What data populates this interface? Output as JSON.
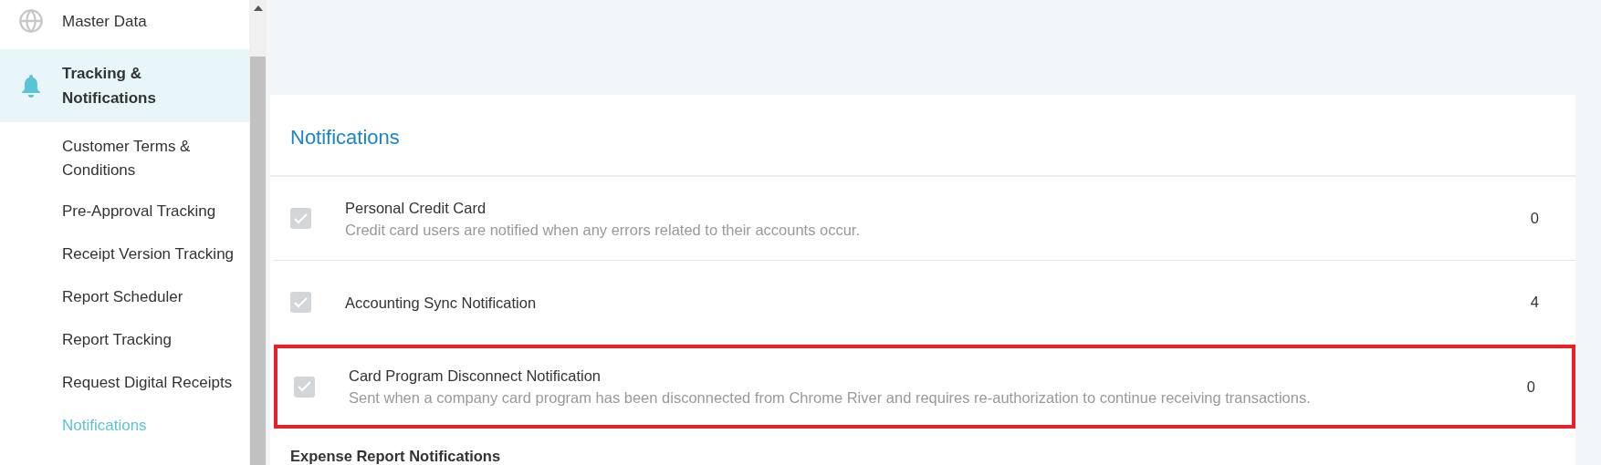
{
  "sidebar": {
    "items": [
      {
        "label": "Master Data",
        "kind": "globe",
        "selected": false
      },
      {
        "label": "Tracking & Notifications",
        "kind": "bell",
        "selected": true,
        "children": [
          {
            "label": "Customer Terms & Conditions",
            "selected": false
          },
          {
            "label": "Pre-Approval Tracking",
            "selected": false
          },
          {
            "label": "Receipt Version Tracking",
            "selected": false
          },
          {
            "label": "Report Scheduler",
            "selected": false
          },
          {
            "label": "Report Tracking",
            "selected": false
          },
          {
            "label": "Request Digital Receipts",
            "selected": false
          },
          {
            "label": "Notifications",
            "selected": true
          }
        ]
      }
    ]
  },
  "page": {
    "title": "Notifications",
    "notifications": [
      {
        "name": "Personal Credit Card",
        "description": "Credit card users are notified when any errors related to their accounts occur.",
        "count": "0",
        "checked": true,
        "highlighted": false
      },
      {
        "name": "Accounting Sync Notification",
        "count": "4",
        "checked": true,
        "highlighted": false
      },
      {
        "name": "Card Program Disconnect Notification",
        "description": "Sent when a company card program has been disconnected from Chrome River and requires re-authorization to continue receiving transactions.",
        "count": "0",
        "checked": true,
        "highlighted": true
      }
    ],
    "next_section": "Expense Report Notifications"
  }
}
